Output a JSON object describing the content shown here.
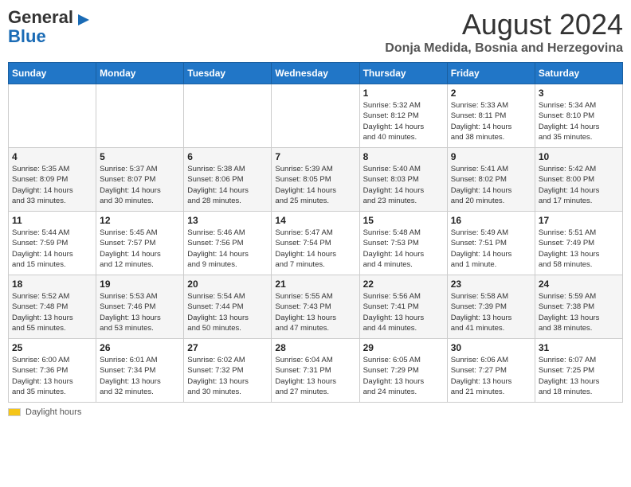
{
  "header": {
    "logo_line1": "General",
    "logo_line2": "Blue",
    "month": "August 2024",
    "location": "Donja Medida, Bosnia and Herzegovina"
  },
  "days_of_week": [
    "Sunday",
    "Monday",
    "Tuesday",
    "Wednesday",
    "Thursday",
    "Friday",
    "Saturday"
  ],
  "weeks": [
    [
      {
        "day": "",
        "info": ""
      },
      {
        "day": "",
        "info": ""
      },
      {
        "day": "",
        "info": ""
      },
      {
        "day": "",
        "info": ""
      },
      {
        "day": "1",
        "info": "Sunrise: 5:32 AM\nSunset: 8:12 PM\nDaylight: 14 hours\nand 40 minutes."
      },
      {
        "day": "2",
        "info": "Sunrise: 5:33 AM\nSunset: 8:11 PM\nDaylight: 14 hours\nand 38 minutes."
      },
      {
        "day": "3",
        "info": "Sunrise: 5:34 AM\nSunset: 8:10 PM\nDaylight: 14 hours\nand 35 minutes."
      }
    ],
    [
      {
        "day": "4",
        "info": "Sunrise: 5:35 AM\nSunset: 8:09 PM\nDaylight: 14 hours\nand 33 minutes."
      },
      {
        "day": "5",
        "info": "Sunrise: 5:37 AM\nSunset: 8:07 PM\nDaylight: 14 hours\nand 30 minutes."
      },
      {
        "day": "6",
        "info": "Sunrise: 5:38 AM\nSunset: 8:06 PM\nDaylight: 14 hours\nand 28 minutes."
      },
      {
        "day": "7",
        "info": "Sunrise: 5:39 AM\nSunset: 8:05 PM\nDaylight: 14 hours\nand 25 minutes."
      },
      {
        "day": "8",
        "info": "Sunrise: 5:40 AM\nSunset: 8:03 PM\nDaylight: 14 hours\nand 23 minutes."
      },
      {
        "day": "9",
        "info": "Sunrise: 5:41 AM\nSunset: 8:02 PM\nDaylight: 14 hours\nand 20 minutes."
      },
      {
        "day": "10",
        "info": "Sunrise: 5:42 AM\nSunset: 8:00 PM\nDaylight: 14 hours\nand 17 minutes."
      }
    ],
    [
      {
        "day": "11",
        "info": "Sunrise: 5:44 AM\nSunset: 7:59 PM\nDaylight: 14 hours\nand 15 minutes."
      },
      {
        "day": "12",
        "info": "Sunrise: 5:45 AM\nSunset: 7:57 PM\nDaylight: 14 hours\nand 12 minutes."
      },
      {
        "day": "13",
        "info": "Sunrise: 5:46 AM\nSunset: 7:56 PM\nDaylight: 14 hours\nand 9 minutes."
      },
      {
        "day": "14",
        "info": "Sunrise: 5:47 AM\nSunset: 7:54 PM\nDaylight: 14 hours\nand 7 minutes."
      },
      {
        "day": "15",
        "info": "Sunrise: 5:48 AM\nSunset: 7:53 PM\nDaylight: 14 hours\nand 4 minutes."
      },
      {
        "day": "16",
        "info": "Sunrise: 5:49 AM\nSunset: 7:51 PM\nDaylight: 14 hours\nand 1 minute."
      },
      {
        "day": "17",
        "info": "Sunrise: 5:51 AM\nSunset: 7:49 PM\nDaylight: 13 hours\nand 58 minutes."
      }
    ],
    [
      {
        "day": "18",
        "info": "Sunrise: 5:52 AM\nSunset: 7:48 PM\nDaylight: 13 hours\nand 55 minutes."
      },
      {
        "day": "19",
        "info": "Sunrise: 5:53 AM\nSunset: 7:46 PM\nDaylight: 13 hours\nand 53 minutes."
      },
      {
        "day": "20",
        "info": "Sunrise: 5:54 AM\nSunset: 7:44 PM\nDaylight: 13 hours\nand 50 minutes."
      },
      {
        "day": "21",
        "info": "Sunrise: 5:55 AM\nSunset: 7:43 PM\nDaylight: 13 hours\nand 47 minutes."
      },
      {
        "day": "22",
        "info": "Sunrise: 5:56 AM\nSunset: 7:41 PM\nDaylight: 13 hours\nand 44 minutes."
      },
      {
        "day": "23",
        "info": "Sunrise: 5:58 AM\nSunset: 7:39 PM\nDaylight: 13 hours\nand 41 minutes."
      },
      {
        "day": "24",
        "info": "Sunrise: 5:59 AM\nSunset: 7:38 PM\nDaylight: 13 hours\nand 38 minutes."
      }
    ],
    [
      {
        "day": "25",
        "info": "Sunrise: 6:00 AM\nSunset: 7:36 PM\nDaylight: 13 hours\nand 35 minutes."
      },
      {
        "day": "26",
        "info": "Sunrise: 6:01 AM\nSunset: 7:34 PM\nDaylight: 13 hours\nand 32 minutes."
      },
      {
        "day": "27",
        "info": "Sunrise: 6:02 AM\nSunset: 7:32 PM\nDaylight: 13 hours\nand 30 minutes."
      },
      {
        "day": "28",
        "info": "Sunrise: 6:04 AM\nSunset: 7:31 PM\nDaylight: 13 hours\nand 27 minutes."
      },
      {
        "day": "29",
        "info": "Sunrise: 6:05 AM\nSunset: 7:29 PM\nDaylight: 13 hours\nand 24 minutes."
      },
      {
        "day": "30",
        "info": "Sunrise: 6:06 AM\nSunset: 7:27 PM\nDaylight: 13 hours\nand 21 minutes."
      },
      {
        "day": "31",
        "info": "Sunrise: 6:07 AM\nSunset: 7:25 PM\nDaylight: 13 hours\nand 18 minutes."
      }
    ]
  ],
  "footer": {
    "daylight_label": "Daylight hours"
  }
}
